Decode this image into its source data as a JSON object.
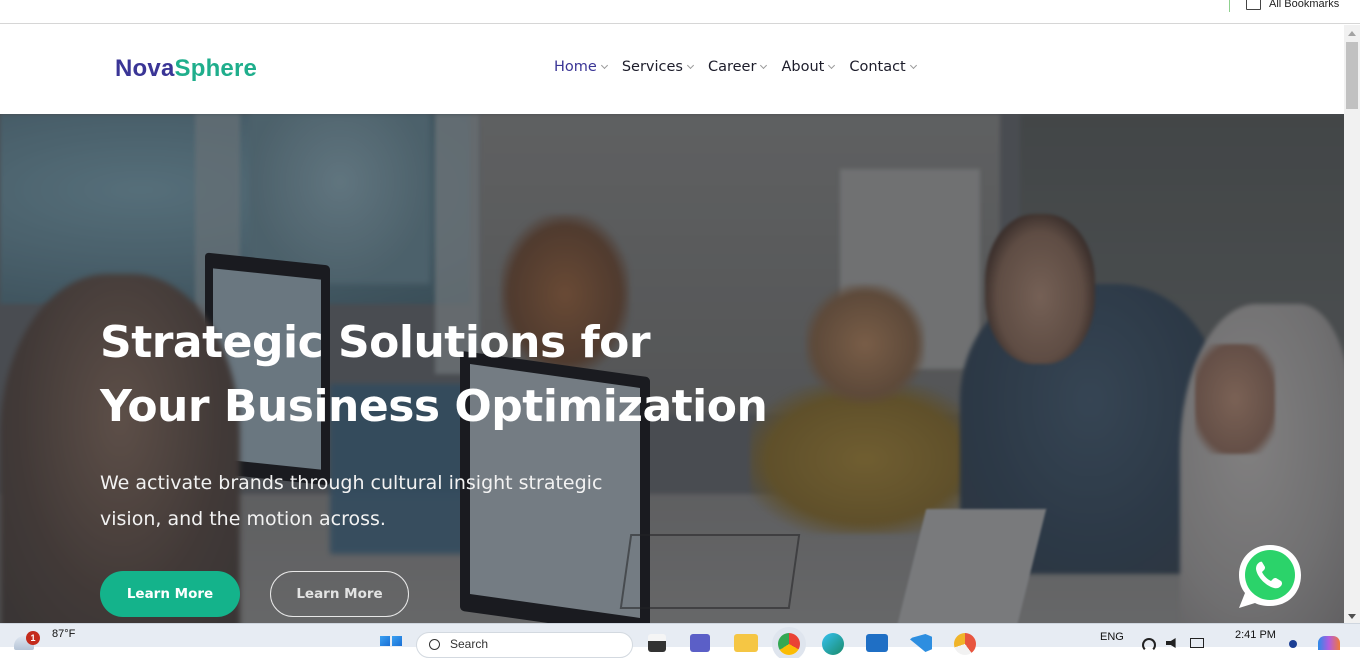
{
  "browser": {
    "bookmarks_label": "All Bookmarks"
  },
  "site": {
    "logo_part1": "Nova",
    "logo_part2": "Sphere",
    "brand_colors": {
      "primary": "#3a3596",
      "accent": "#1fae8c"
    },
    "nav": [
      {
        "label": "Home",
        "active": true
      },
      {
        "label": "Services",
        "active": false
      },
      {
        "label": "Career",
        "active": false
      },
      {
        "label": "About",
        "active": false
      },
      {
        "label": "Contact",
        "active": false
      }
    ]
  },
  "hero": {
    "title_line1": "Strategic Solutions for",
    "title_line2": "Your Business Optimization",
    "subtitle_line1": "We activate brands through cultural insight strategic",
    "subtitle_line2": "vision, and the motion across.",
    "primary_button": "Learn More",
    "secondary_button": "Learn More",
    "primary_color": "#14b38b",
    "chat_widget_icon": "whatsapp-icon"
  },
  "taskbar": {
    "weather_temp": "87°F",
    "weather_badge": "1",
    "search_placeholder": "Search",
    "language": "ENG",
    "time": "2:41 PM",
    "apps": [
      "file-explorer-icon",
      "teams-icon",
      "folder-icon",
      "chrome-icon",
      "edge-icon",
      "store-icon",
      "vscode-icon",
      "chrome-canary-icon"
    ]
  }
}
